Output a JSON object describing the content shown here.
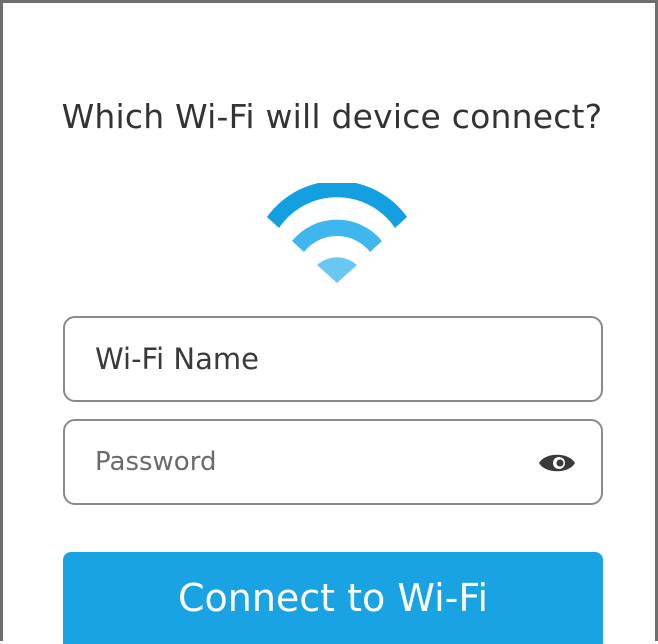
{
  "header": {
    "title": "Which Wi-Fi will device connect?"
  },
  "wifi_icon": {
    "name": "wifi-icon",
    "colors": {
      "top_arc": "#149fe0",
      "middle_arc": "#3fb7ee",
      "dot": "#69c8f2"
    }
  },
  "form": {
    "wifi_name": {
      "placeholder": "Wi-Fi Name",
      "value": ""
    },
    "password": {
      "placeholder": "Password",
      "value": "",
      "visibility_icon": "eye-icon"
    }
  },
  "actions": {
    "connect_label": "Connect to Wi-Fi"
  },
  "colors": {
    "accent": "#1aa3e2",
    "border": "#8a8a8a",
    "text": "#333333"
  }
}
